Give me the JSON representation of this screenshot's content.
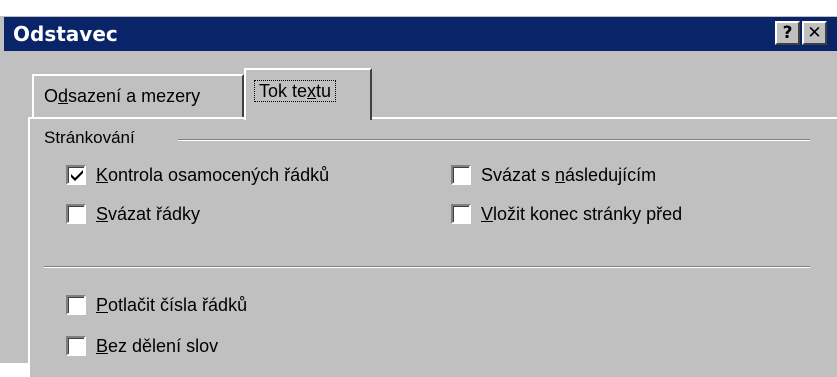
{
  "dialog": {
    "title": "Odstavec",
    "help_button": "?",
    "close_button": "✕"
  },
  "tabs": [
    {
      "label_prefix": "O",
      "label_mnemonic": "d",
      "label_rest": "sazení a mezery",
      "active": false
    },
    {
      "label_prefix": "Tok te",
      "label_mnemonic": "x",
      "label_rest": "tu",
      "active": true
    }
  ],
  "pagination_group": {
    "label": "Stránkování",
    "options": [
      {
        "pre": "",
        "mn": "K",
        "post": "ontrola osamocených řádků",
        "checked": true
      },
      {
        "pre": "Svázat s ",
        "mn": "n",
        "post": "ásledujícím",
        "checked": false
      },
      {
        "pre": "",
        "mn": "S",
        "post": "vázat řádky",
        "checked": false
      },
      {
        "pre": "",
        "mn": "V",
        "post": "ložit konec stránky před",
        "checked": false
      }
    ]
  },
  "other_options": [
    {
      "pre": "",
      "mn": "P",
      "post": "otlačit čísla řádků",
      "checked": false
    },
    {
      "pre": "",
      "mn": "B",
      "post": "ez dělení slov",
      "checked": false
    }
  ],
  "colors": {
    "titlebar": "#0a246a",
    "face": "#c0c0c0"
  }
}
